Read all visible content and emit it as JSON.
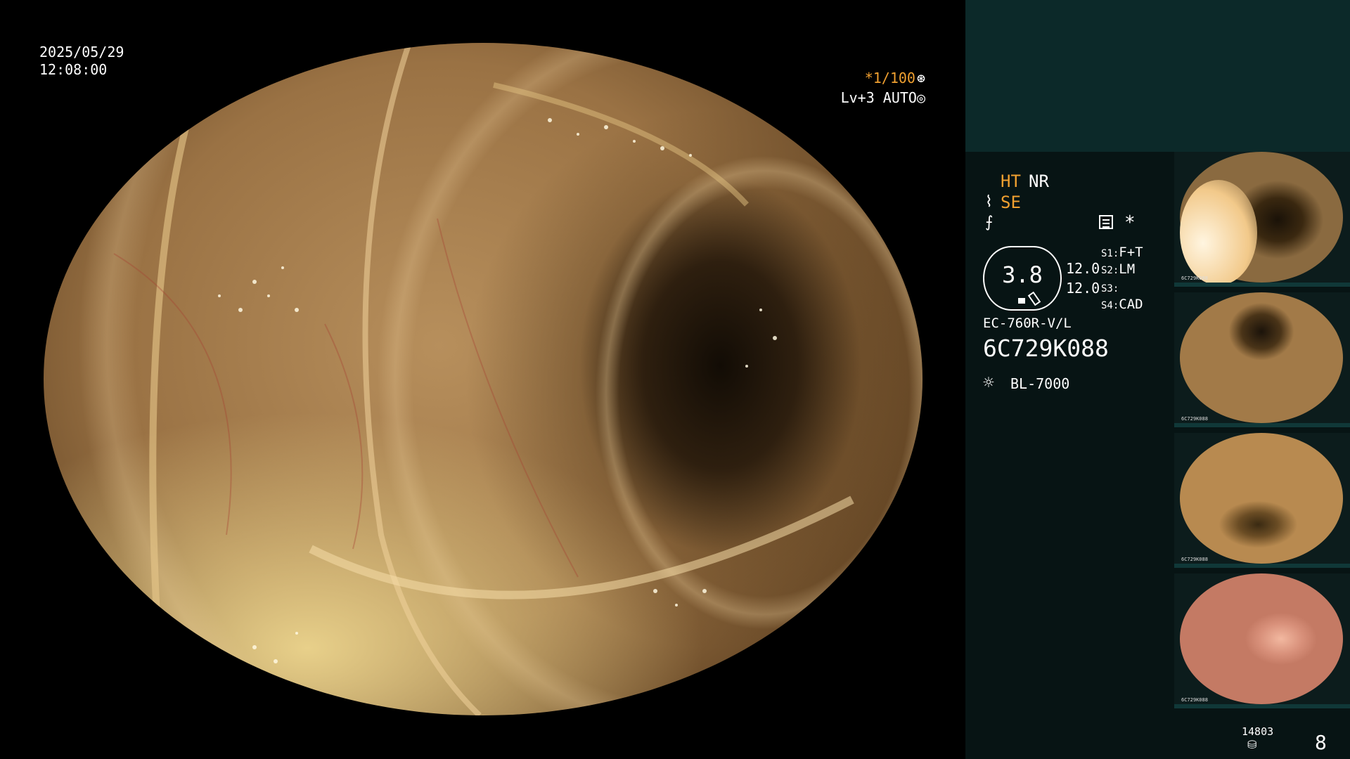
{
  "overlay": {
    "date": "2025/05/29",
    "time": "12:08:00",
    "shutter": "*1/100",
    "shutter_icon": "⊛",
    "level": "Lv+3 AUTO",
    "level_icon": "◎"
  },
  "panel": {
    "ht": "HT",
    "nr": "NR",
    "se_icon": "⌇",
    "se": "SE",
    "f_icon": "⨍",
    "asterisk": "*",
    "gauge_value": "3.8",
    "value1": "12.0",
    "value2": "12.0",
    "settings": [
      {
        "key": "S1:",
        "value": "F+T"
      },
      {
        "key": "S2:",
        "value": "LM"
      },
      {
        "key": "S3:",
        "value": ""
      },
      {
        "key": "S4:",
        "value": "CAD"
      }
    ],
    "scope_model": "EC-760R-V/L",
    "serial": "6C729K088",
    "lamp_icon": "☼",
    "lamp": "BL-7000",
    "thumbnail_meta": "6C729K088",
    "counter": "14803",
    "counter_icon": "⛁",
    "page": "8"
  },
  "colors": {
    "accent": "#f0a030",
    "panel_bg": "#071414",
    "panel_top": "#0c2929"
  }
}
